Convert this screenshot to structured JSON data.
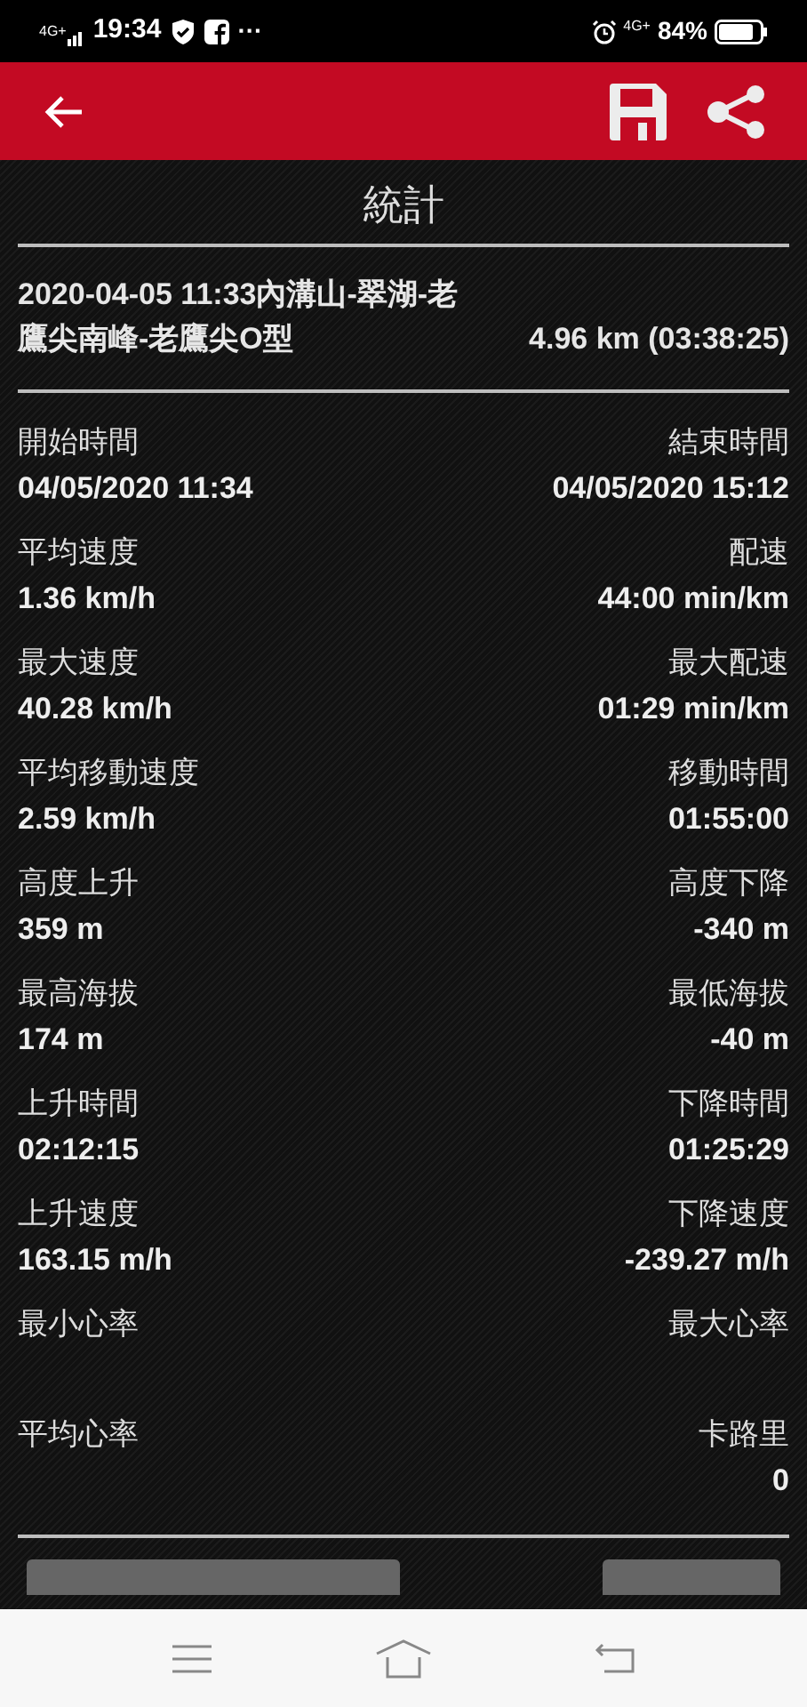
{
  "status_bar": {
    "network_left": "4G+",
    "time": "19:34",
    "more": "···",
    "network_right": "4G+",
    "battery": "84%"
  },
  "title": "統計",
  "track": {
    "name": "2020-04-05 11:33內溝山-翠湖-老鷹尖南峰-老鷹尖O型",
    "summary": "4.96 km (03:38:25)"
  },
  "stats": [
    {
      "left_label": "開始時間",
      "left_value": "04/05/2020 11:34",
      "right_label": "結束時間",
      "right_value": "04/05/2020 15:12"
    },
    {
      "left_label": "平均速度",
      "left_value": "1.36 km/h",
      "right_label": "配速",
      "right_value": "44:00 min/km"
    },
    {
      "left_label": "最大速度",
      "left_value": "40.28 km/h",
      "right_label": "最大配速",
      "right_value": "01:29 min/km"
    },
    {
      "left_label": "平均移動速度",
      "left_value": "2.59 km/h",
      "right_label": "移動時間",
      "right_value": "01:55:00"
    },
    {
      "left_label": "高度上升",
      "left_value": "359 m",
      "right_label": "高度下降",
      "right_value": "-340 m"
    },
    {
      "left_label": "最高海拔",
      "left_value": "174 m",
      "right_label": "最低海拔",
      "right_value": "-40 m"
    },
    {
      "left_label": "上升時間",
      "left_value": "02:12:15",
      "right_label": "下降時間",
      "right_value": "01:25:29"
    },
    {
      "left_label": "上升速度",
      "left_value": "163.15 m/h",
      "right_label": "下降速度",
      "right_value": "-239.27 m/h"
    },
    {
      "left_label": "最小心率",
      "right_label": "最大心率"
    },
    {
      "left_label": "平均心率",
      "right_label": "卡路里",
      "right_value": "0"
    }
  ]
}
